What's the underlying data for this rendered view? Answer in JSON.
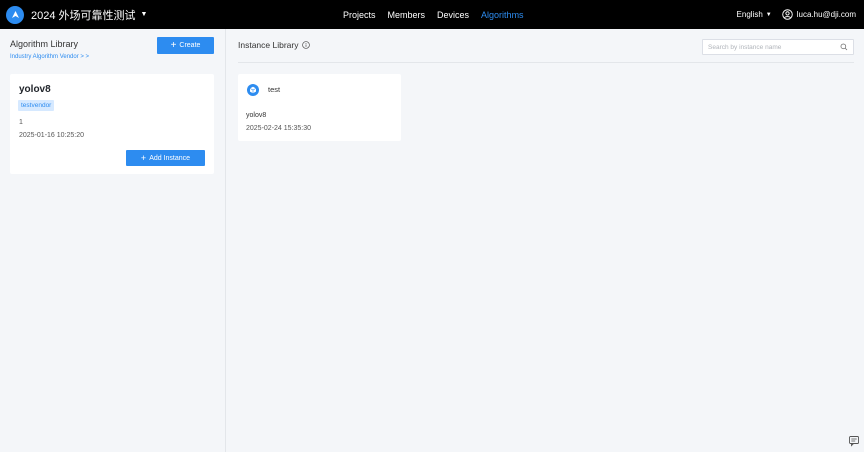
{
  "header": {
    "project_title": "2024 外场可靠性测试",
    "nav": [
      {
        "label": "Projects",
        "active": false
      },
      {
        "label": "Members",
        "active": false
      },
      {
        "label": "Devices",
        "active": false
      },
      {
        "label": "Algorithms",
        "active": true
      }
    ],
    "language": "English",
    "user_email": "luca.hu@dji.com",
    "accent_color": "#2d8cf0"
  },
  "algorithm_library": {
    "title": "Algorithm Library",
    "vendor_link": "Industry Algorithm Vendor > >",
    "create_label": "Create",
    "algorithms": [
      {
        "name": "yolov8",
        "vendor": "testvendor",
        "count": "1",
        "date": "2025-01-16 10:25:20",
        "add_label": "Add Instance"
      }
    ]
  },
  "instance_library": {
    "title": "Instance Library",
    "search_placeholder": "Search by instance name",
    "instances": [
      {
        "name": "test",
        "algorithm": "yolov8",
        "date": "2025-02-24 15:35:30"
      }
    ]
  },
  "icons": {
    "brand": "drone-logo-icon",
    "user": "user-avatar-icon",
    "info": "info-circle-icon",
    "search": "search-icon",
    "instance": "cube-icon",
    "feedback": "feedback-icon"
  }
}
